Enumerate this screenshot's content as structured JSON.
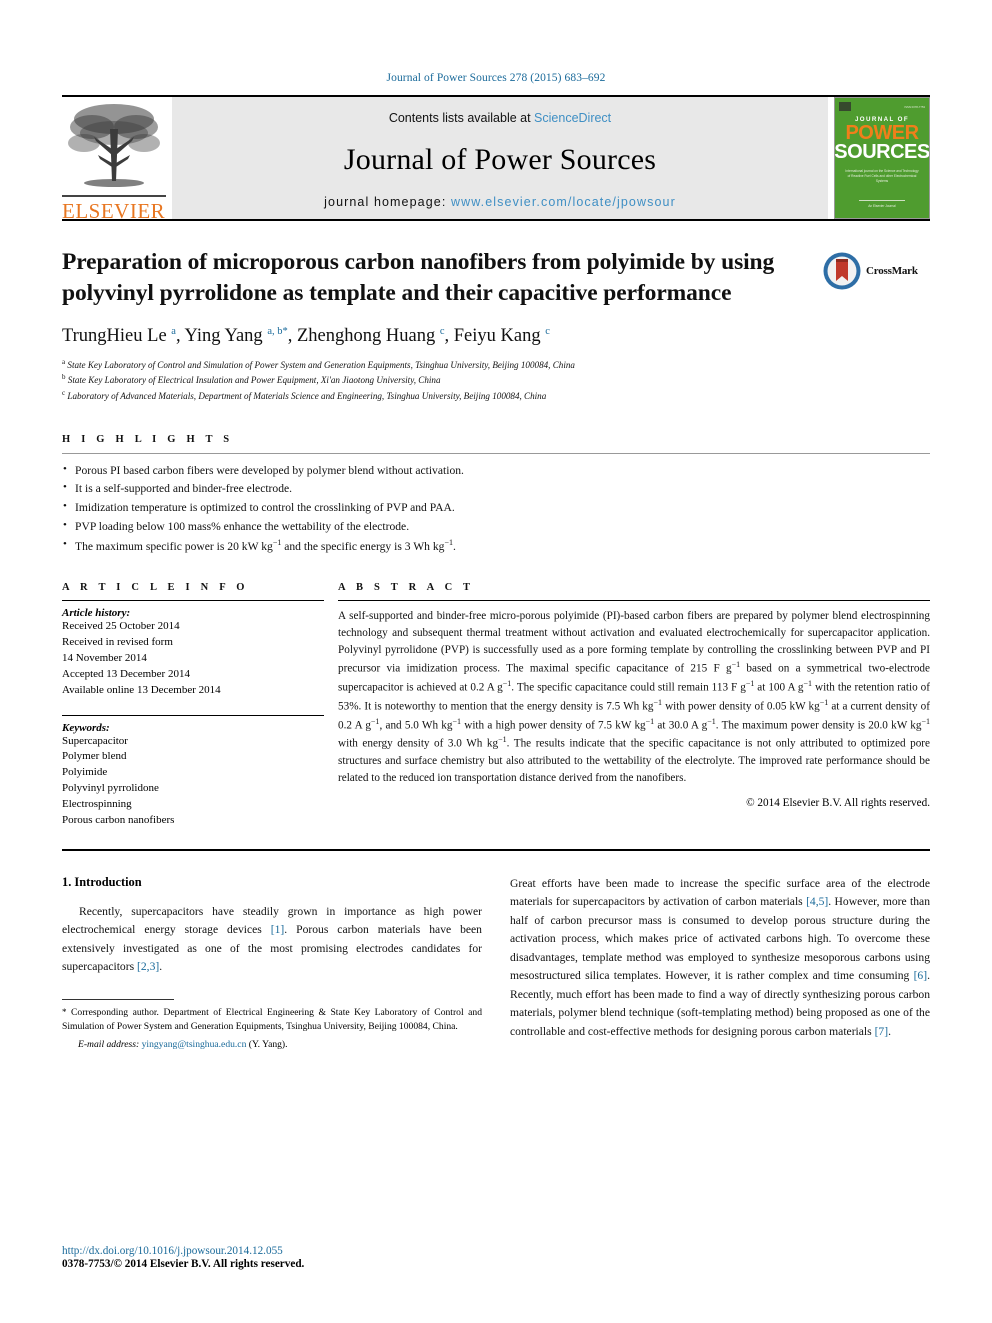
{
  "running_head": "Journal of Power Sources 278 (2015) 683–692",
  "masthead": {
    "contents_prefix": "Contents lists available at ",
    "contents_link": "ScienceDirect",
    "journal_name": "Journal of Power Sources",
    "homepage_prefix": "journal homepage: ",
    "homepage_link": "www.elsevier.com/locate/jpowsour",
    "publisher_logo": "ELSEVIER",
    "cover": {
      "kicker": "JOURNAL OF",
      "word1": "POWER",
      "word2": "SOURCES",
      "blurb": "International journal on the Science and Technology of Reactive Fuel Cells and other Electrochemical Systems",
      "footer": "An Elsevier Journal"
    }
  },
  "article": {
    "title": "Preparation of microporous carbon nanofibers from polyimide by using polyvinyl pyrrolidone as template and their capacitive performance",
    "crossmark_label": "CrossMark",
    "authors": [
      {
        "name": "TrungHieu Le",
        "marks": "a",
        "corresponding": false
      },
      {
        "name": "Ying Yang",
        "marks": "a, b",
        "corresponding": true
      },
      {
        "name": "Zhenghong Huang",
        "marks": "c",
        "corresponding": false
      },
      {
        "name": "Feiyu Kang",
        "marks": "c",
        "corresponding": false
      }
    ],
    "affiliations": [
      {
        "label": "a",
        "text": "State Key Laboratory of Control and Simulation of Power System and Generation Equipments, Tsinghua University, Beijing 100084, China"
      },
      {
        "label": "b",
        "text": "State Key Laboratory of Electrical Insulation and Power Equipment, Xi'an Jiaotong University, China"
      },
      {
        "label": "c",
        "text": "Laboratory of Advanced Materials, Department of Materials Science and Engineering, Tsinghua University, Beijing 100084, China"
      }
    ]
  },
  "highlights": {
    "heading": "H I G H L I G H T S",
    "items": [
      "Porous PI based carbon fibers were developed by polymer blend without activation.",
      "It is a self-supported and binder-free electrode.",
      "Imidization temperature is optimized to control the crosslinking of PVP and PAA.",
      "PVP loading below 100 mass% enhance the wettability of the electrode.",
      "The maximum specific power is 20 kW kg−1 and the specific energy is 3 Wh kg−1."
    ]
  },
  "article_info": {
    "heading": "A R T I C L E   I N F O",
    "history_title": "Article history:",
    "history": [
      "Received 25 October 2014",
      "Received in revised form",
      "14 November 2014",
      "Accepted 13 December 2014",
      "Available online 13 December 2014"
    ],
    "keywords_title": "Keywords:",
    "keywords": [
      "Supercapacitor",
      "Polymer blend",
      "Polyimide",
      "Polyvinyl pyrrolidone",
      "Electrospinning",
      "Porous carbon nanofibers"
    ]
  },
  "abstract": {
    "heading": "A B S T R A C T",
    "text": "A self-supported and binder-free micro-porous polyimide (PI)-based carbon fibers are prepared by polymer blend electrospinning technology and subsequent thermal treatment without activation and evaluated electrochemically for supercapacitor application. Polyvinyl pyrrolidone (PVP) is successfully used as a pore forming template by controlling the crosslinking between PVP and PI precursor via imidization process. The maximal specific capacitance of 215 F g−1 based on a symmetrical two-electrode supercapacitor is achieved at 0.2 A g−1. The specific capacitance could still remain 113 F g−1 at 100 A g−1 with the retention ratio of 53%. It is noteworthy to mention that the energy density is 7.5 Wh kg−1 with power density of 0.05 kW kg−1 at a current density of 0.2 A g−1, and 5.0 Wh kg−1 with a high power density of 7.5 kW kg−1 at 30.0 A g−1. The maximum power density is 20.0 kW kg−1 with energy density of 3.0 Wh kg−1. The results indicate that the specific capacitance is not only attributed to optimized pore structures and surface chemistry but also attributed to the wettability of the electrolyte. The improved rate performance should be related to the reduced ion transportation distance derived from the nanofibers.",
    "copyright": "© 2014 Elsevier B.V. All rights reserved."
  },
  "body": {
    "section_title": "1.  Introduction",
    "left_paragraph": "Recently, supercapacitors have steadily grown in importance as high power electrochemical energy storage devices [1]. Porous carbon materials have been extensively investigated as one of the most promising electrodes candidates for supercapacitors [2,3].",
    "right_paragraph": "Great efforts have been made to increase the specific surface area of the electrode materials for supercapacitors by activation of carbon materials [4,5]. However, more than half of carbon precursor mass is consumed to develop porous structure during the activation process, which makes price of activated carbons high. To overcome these disadvantages, template method was employed to synthesize mesoporous carbons using mesostructured silica templates. However, it is rather complex and time consuming [6]. Recently, much effort has been made to find a way of directly synthesizing porous carbon materials, polymer blend technique (soft-templating method) being proposed as one of the controllable and cost-effective methods for designing porous carbon materials [7]."
  },
  "footnote": {
    "star": "*",
    "text": "Corresponding author. Department of Electrical Engineering & State Key Laboratory of Control and Simulation of Power System and Generation Equipments, Tsinghua University, Beijing 100084, China.",
    "email_label": "E-mail address:",
    "email": "yingyang@tsinghua.edu.cn",
    "email_suffix": "(Y. Yang)."
  },
  "footer": {
    "doi": "http://dx.doi.org/10.1016/j.jpowsour.2014.12.055",
    "issn": "0378-7753/© 2014 Elsevier B.V. All rights reserved."
  },
  "colors": {
    "link_blue": "#1a6a9a",
    "sciencedirect_blue": "#3f8fc4",
    "elsevier_orange": "#E87722",
    "cover_green": "#4f9c2f",
    "cover_orange": "#F07F1A"
  }
}
